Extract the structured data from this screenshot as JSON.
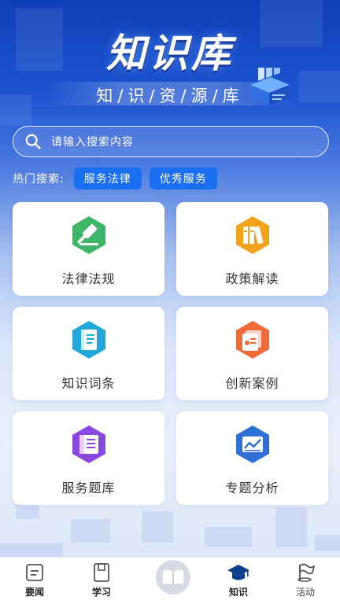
{
  "header": {
    "title": "知识库",
    "subtitle": "知/识/资/源/库"
  },
  "search": {
    "placeholder": "请输入搜索内容"
  },
  "hot_search": {
    "label": "热门搜索:",
    "tags": [
      "服务法律",
      "优秀服务"
    ]
  },
  "categories": [
    {
      "label": "法律法规",
      "icon": "gavel-icon",
      "color": "#3fb56a"
    },
    {
      "label": "政策解读",
      "icon": "books-icon",
      "color": "#f2a31c"
    },
    {
      "label": "知识词条",
      "icon": "book-icon",
      "color": "#22a8d8"
    },
    {
      "label": "创新案例",
      "icon": "certificate-icon",
      "color": "#f06a3a"
    },
    {
      "label": "服务题库",
      "icon": "question-bank-icon",
      "color": "#8a48e0"
    },
    {
      "label": "专题分析",
      "icon": "chart-icon",
      "color": "#2f6fd6"
    }
  ],
  "tabbar": {
    "items": [
      {
        "label": "要闻",
        "icon": "news-icon"
      },
      {
        "label": "学习",
        "icon": "study-icon"
      },
      {
        "label": "",
        "icon": "open-book-icon"
      },
      {
        "label": "知识",
        "icon": "graduation-cap-icon"
      },
      {
        "label": "活动",
        "icon": "flag-icon"
      }
    ]
  }
}
